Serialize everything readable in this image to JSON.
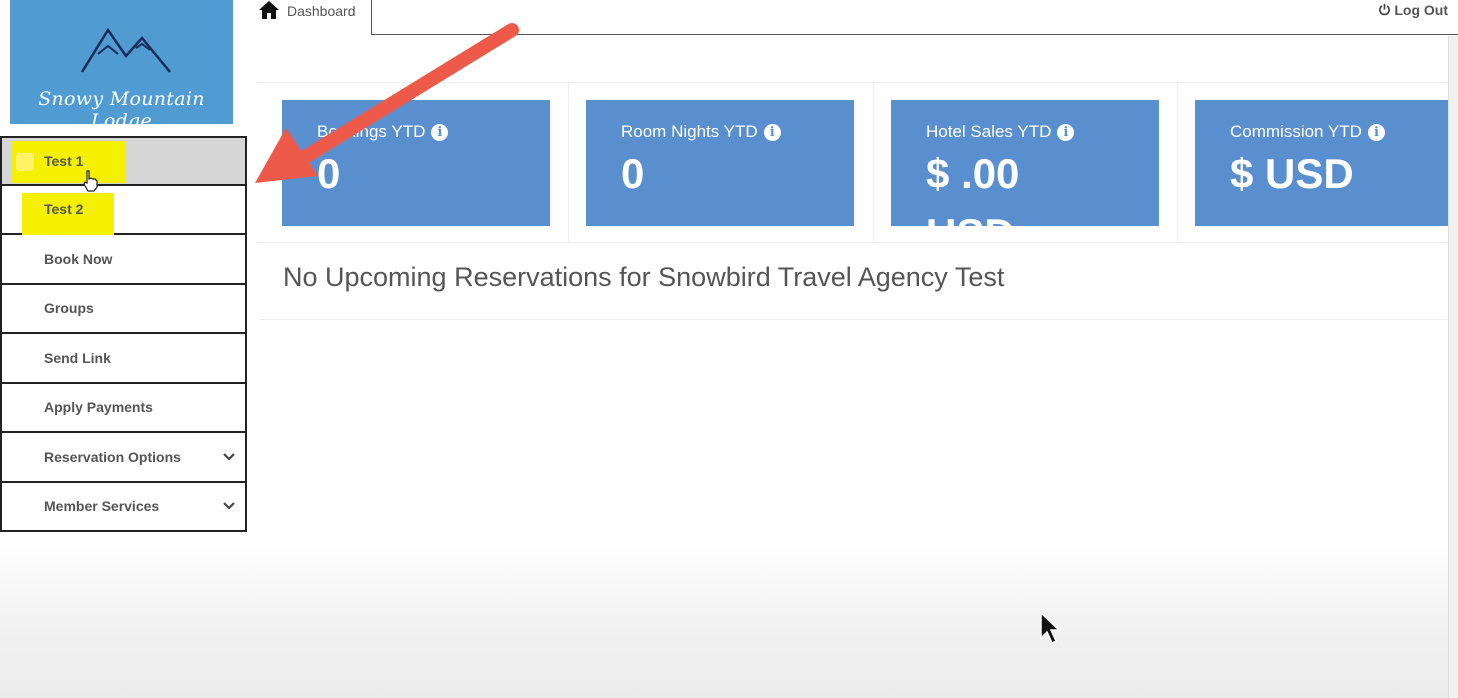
{
  "logo": {
    "text": "Snowy Mountain Lodge",
    "color": "#4f9bd2"
  },
  "topbar": {
    "tab_label": "Dashboard",
    "tab_icon": "home-icon",
    "logout_label": "Log Out",
    "logout_icon": "power-icon"
  },
  "sidebar": {
    "items": [
      {
        "label": "Test 1",
        "highlighted": true,
        "active": true
      },
      {
        "label": "Test 2",
        "highlighted": true
      },
      {
        "label": "Book Now"
      },
      {
        "label": "Groups"
      },
      {
        "label": "Send Link"
      },
      {
        "label": "Apply Payments"
      },
      {
        "label": "Reservation Options",
        "has_dropdown": true
      },
      {
        "label": "Member Services",
        "has_dropdown": true
      }
    ]
  },
  "stats": {
    "cards": [
      {
        "title": "Bookings YTD",
        "value": "0",
        "icon": "info-icon"
      },
      {
        "title": "Room Nights YTD",
        "value": "0",
        "icon": "info-icon"
      },
      {
        "title": "Hotel Sales YTD",
        "value": "$ .00",
        "unit": "USD",
        "icon": "info-icon"
      },
      {
        "title": "Commission YTD",
        "value": "$ USD",
        "icon": "info-icon"
      }
    ],
    "card_color": "#5a8fcf"
  },
  "message": "No Upcoming Reservations for Snowbird Travel Agency Test",
  "annotation": {
    "arrow_color": "#ee5a4a",
    "highlight_color": "#f5f000"
  }
}
